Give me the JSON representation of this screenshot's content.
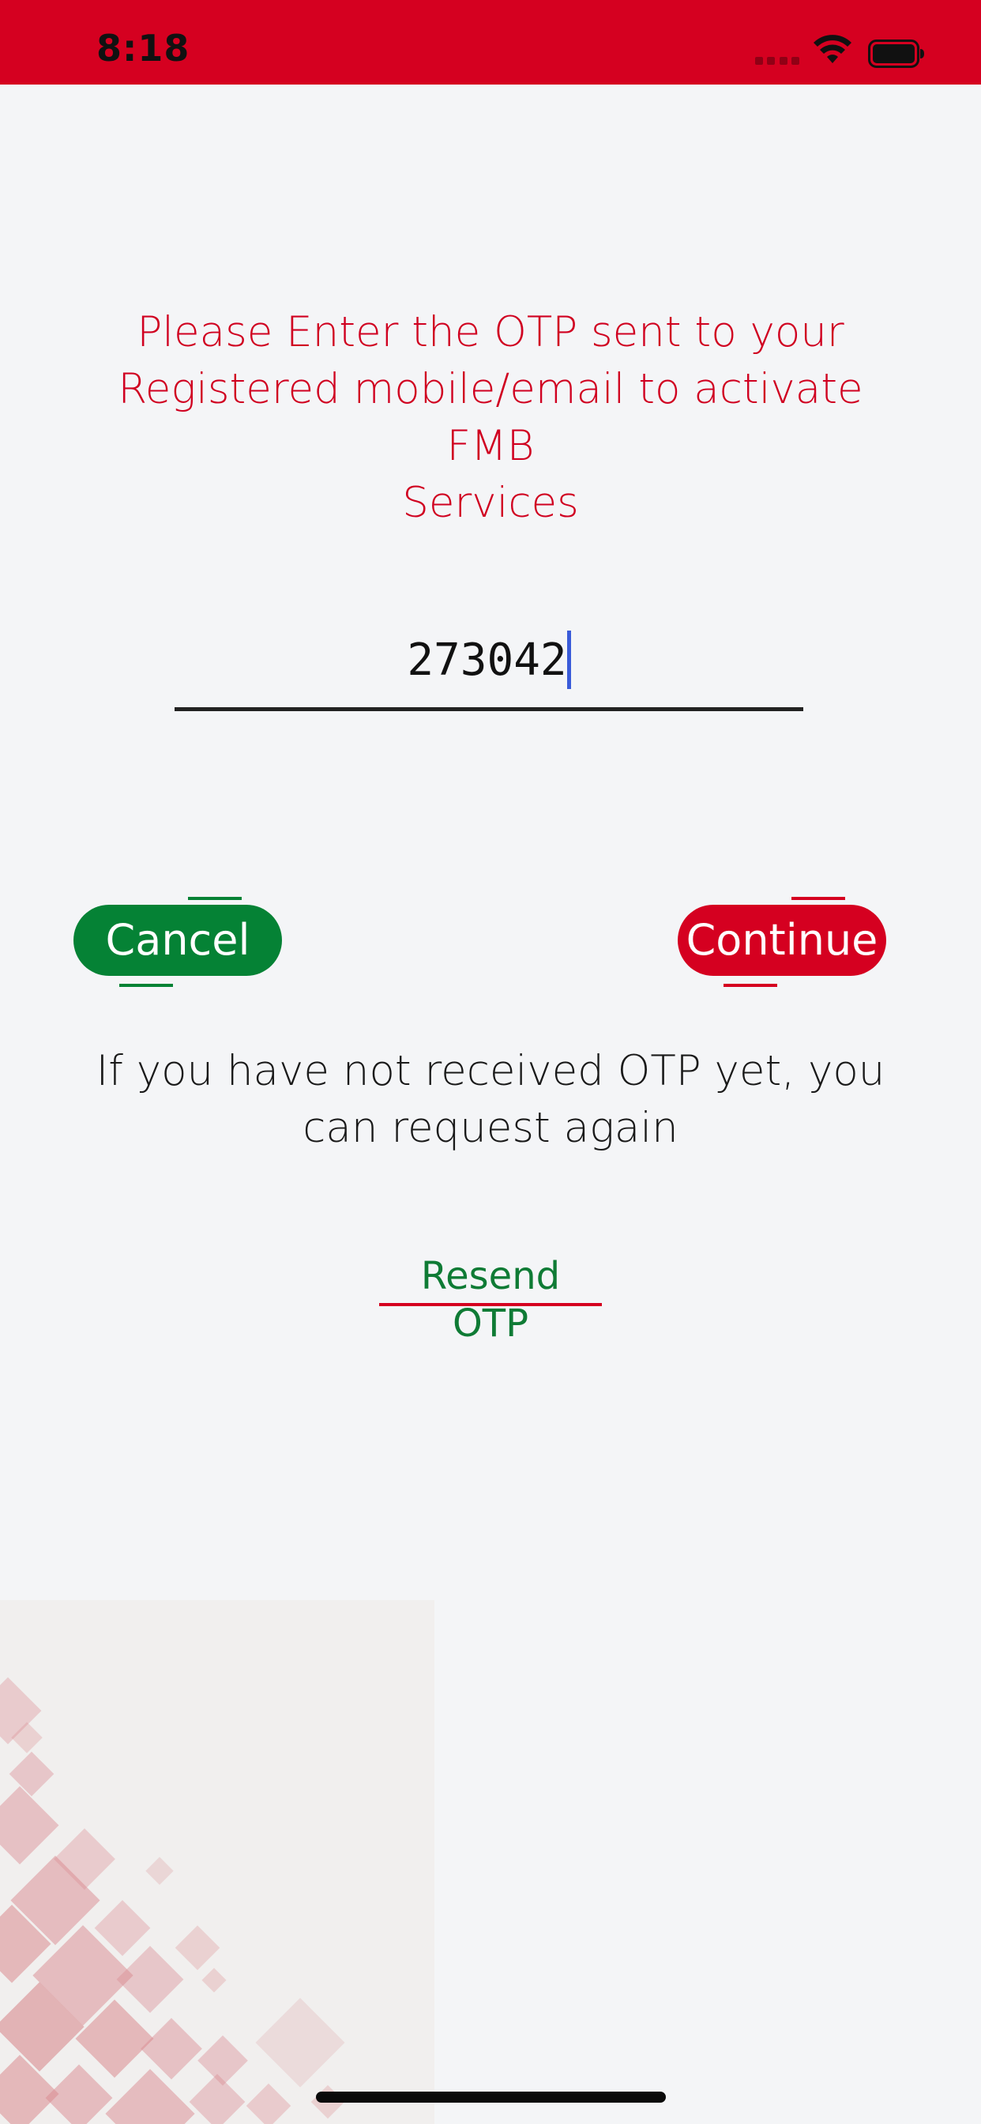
{
  "status_bar": {
    "time": "8:18",
    "background": "#d50020"
  },
  "otp_screen": {
    "prompt_line1": "Please Enter the OTP sent to your",
    "prompt_line2": "Registered mobile/email to activate FMB",
    "prompt_line3": "Services",
    "otp_value": "273042",
    "cancel_label": "Cancel",
    "continue_label": "Continue",
    "resend_info_line1": "If you have not received OTP yet, you",
    "resend_info_line2": "can request again",
    "resend_label": "Resend OTP"
  },
  "colors": {
    "brand_red": "#d50020",
    "brand_green": "#058235",
    "link_green": "#0f7b35",
    "background": "#f4f5f7"
  },
  "icons": [
    "wifi-icon",
    "battery-icon",
    "signal-icon"
  ]
}
